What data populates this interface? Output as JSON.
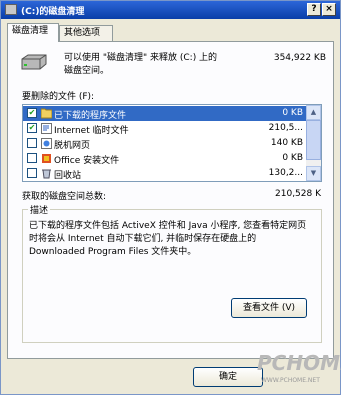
{
  "window": {
    "title": "(C:)的磁盘清理",
    "help_btn": "?",
    "close_btn": "×"
  },
  "tabs": [
    {
      "label": "磁盘清理",
      "active": true
    },
    {
      "label": "其他选项",
      "active": false
    }
  ],
  "intro": {
    "line1_left": "可以使用 \"磁盘清理\" 来释放 (C:) 上的",
    "line1_right": "354,922 KB",
    "line2": "磁盘空间。"
  },
  "files_label": "要删除的文件 (F):",
  "files": [
    {
      "name": "已下载的程序文件",
      "size": "0 KB",
      "checked": true,
      "selected": true
    },
    {
      "name": "Internet 临时文件",
      "size": "210,5...",
      "checked": true,
      "selected": false
    },
    {
      "name": "脱机网页",
      "size": "140 KB",
      "checked": false,
      "selected": false
    },
    {
      "name": "Office 安装文件",
      "size": "0 KB",
      "checked": false,
      "selected": false
    },
    {
      "name": "回收站",
      "size": "130,2...",
      "checked": false,
      "selected": false
    }
  ],
  "total": {
    "label": "获取的磁盘空间总数:",
    "value": "210,528 K"
  },
  "description": {
    "title": "描述",
    "text": "已下载的程序文件包括 ActiveX 控件和 Java 小程序, 您查看特定网页时将会从 Internet 自动下载它们, 并临时保存在硬盘上的 Downloaded Program Files 文件夹中。"
  },
  "view_files_button": "查看文件 (V)",
  "ok_button": "确定",
  "watermark": {
    "big": "PCHOME",
    "small": "WWW.PCHOME.NET"
  },
  "colors": {
    "titlebar": "#0a3ea8",
    "selection": "#316ac5"
  }
}
